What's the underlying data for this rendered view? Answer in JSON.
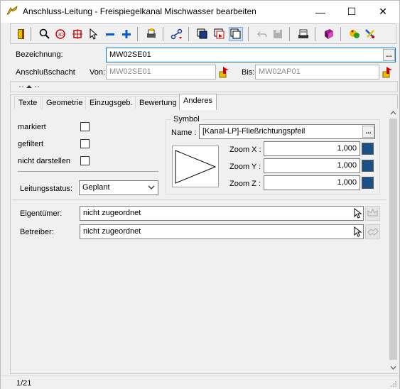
{
  "window": {
    "title": "Anschluss-Leitung - Freispiegelkanal Mischwasser bearbeiten",
    "minimize_glyph": "—",
    "maximize_glyph": "☐",
    "close_glyph": "✕"
  },
  "toolbar": {
    "icons": [
      "door-exit-icon",
      "zoom-icon",
      "zoom-area-icon",
      "crosshair-icon",
      "pointer-icon",
      "minus-icon",
      "plus-icon",
      "print-icon",
      "network-icon",
      "layers-icon",
      "select-window-icon",
      "window-copy-icon",
      "undo-icon",
      "save-icon",
      "scanner-icon",
      "book-icon",
      "palette-icon",
      "tools-icon"
    ]
  },
  "form": {
    "bezeichnung_label": "Bezeichnung:",
    "bezeichnung_value": "MW02SE01",
    "anschlussschacht_label": "Anschlußschacht",
    "von_label": "Von:",
    "von_value": "MW02SE01",
    "bis_label": "Bis:",
    "bis_value": "MW02AP01",
    "dots": "..."
  },
  "tabs": [
    {
      "label": "Texte",
      "active": false
    },
    {
      "label": "Geometrie",
      "active": false
    },
    {
      "label": "Einzugsgeb.",
      "active": false
    },
    {
      "label": "Bewertung",
      "active": false
    },
    {
      "label": "Anderes",
      "active": true
    }
  ],
  "anderes": {
    "markiert_label": "markiert",
    "markiert_checked": false,
    "gefiltert_label": "gefiltert",
    "gefiltert_checked": false,
    "nicht_darstellen_label": "nicht darstellen",
    "nicht_darstellen_checked": false,
    "leitungsstatus_label": "Leitungsstatus:",
    "leitungsstatus_value": "Geplant",
    "symbol": {
      "group_label": "Symbol",
      "name_label": "Name :",
      "name_value": "[Kanal-LP]-Fließrichtungspfeil",
      "zoom_x_label": "Zoom X :",
      "zoom_x_value": "1,000",
      "zoom_y_label": "Zoom Y :",
      "zoom_y_value": "1,000",
      "zoom_z_label": "Zoom Z :",
      "zoom_z_value": "1,000"
    },
    "eigentuemer_label": "Eigentümer:",
    "eigentuemer_value": "nicht zugeordnet",
    "betreiber_label": "Betreiber:",
    "betreiber_value": "nicht zugeordnet"
  },
  "status": {
    "record": "1/21"
  }
}
